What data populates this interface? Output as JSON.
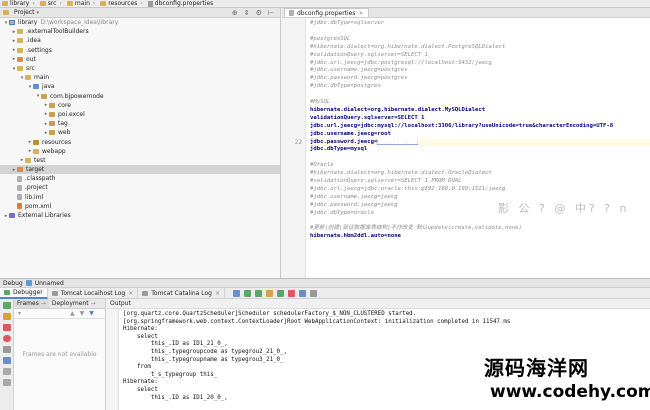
{
  "breadcrumb": [
    "library",
    "src",
    "main",
    "resources",
    "dbconfig.properties"
  ],
  "project_panel": {
    "title": "Project",
    "tree": [
      {
        "label": "library",
        "path": "D:\\workspace_idea\\library",
        "icon": "module",
        "indent": 0,
        "arrow": "▾"
      },
      {
        "label": ".externalToolBuilders",
        "icon": "folder",
        "indent": 1,
        "arrow": "▸"
      },
      {
        "label": ".idea",
        "icon": "folder",
        "indent": 1,
        "arrow": "▸"
      },
      {
        "label": ".settings",
        "icon": "folder",
        "indent": 1,
        "arrow": "▸"
      },
      {
        "label": "out",
        "icon": "excl",
        "indent": 1,
        "arrow": "▸"
      },
      {
        "label": "src",
        "icon": "folder",
        "indent": 1,
        "arrow": "▾"
      },
      {
        "label": "main",
        "icon": "folder",
        "indent": 2,
        "arrow": "▾"
      },
      {
        "label": "java",
        "icon": "src",
        "indent": 3,
        "arrow": "▾"
      },
      {
        "label": "com.bjpowernode",
        "icon": "pkg",
        "indent": 4,
        "arrow": "▾"
      },
      {
        "label": "core",
        "icon": "pkg",
        "indent": 5,
        "arrow": "▸"
      },
      {
        "label": "poi.excel",
        "icon": "pkg",
        "indent": 5,
        "arrow": "▸"
      },
      {
        "label": "tag",
        "icon": "pkg",
        "indent": 5,
        "arrow": "▸"
      },
      {
        "label": "web",
        "icon": "pkg",
        "indent": 5,
        "arrow": "▸"
      },
      {
        "label": "resources",
        "icon": "res",
        "indent": 3,
        "arrow": "▸"
      },
      {
        "label": "webapp",
        "icon": "folder",
        "indent": 3,
        "arrow": "▸"
      },
      {
        "label": "test",
        "icon": "folder",
        "indent": 2,
        "arrow": "▸"
      },
      {
        "label": "target",
        "icon": "excl",
        "indent": 1,
        "arrow": "▸",
        "selected": true
      },
      {
        "label": ".classpath",
        "icon": "file",
        "indent": 1,
        "arrow": ""
      },
      {
        "label": ".project",
        "icon": "file",
        "indent": 1,
        "arrow": ""
      },
      {
        "label": "lib.iml",
        "icon": "file",
        "indent": 1,
        "arrow": ""
      },
      {
        "label": "pom.xml",
        "icon": "xml",
        "indent": 1,
        "arrow": ""
      },
      {
        "label": "External Libraries",
        "icon": "lib",
        "indent": 0,
        "arrow": "▸"
      }
    ]
  },
  "editor": {
    "tab_label": "dbconfig.properties",
    "lines": [
      {
        "n": "",
        "t": "#jdbc.dbType=sqlserver",
        "k": "cmt"
      },
      {
        "n": "",
        "t": "",
        "k": "cmt"
      },
      {
        "n": "",
        "t": "#postgresSQL",
        "k": "cmt"
      },
      {
        "n": "",
        "t": "#hibernate.dialect=org.hibernate.dialect.PostgreSQLDialect",
        "k": "cmt"
      },
      {
        "n": "",
        "t": "#validationQuery.sqlserver=SELECT 1",
        "k": "cmt"
      },
      {
        "n": "",
        "t": "#jdbc.url.jeecg=jdbc:postgresql://localhost:5432/jeecg",
        "k": "cmt"
      },
      {
        "n": "",
        "t": "#jdbc.username.jeecg=postgres",
        "k": "cmt"
      },
      {
        "n": "",
        "t": "#jdbc.password.jeecg=postgres",
        "k": "cmt"
      },
      {
        "n": "",
        "t": "#jdbc.dbType=postgres",
        "k": "cmt"
      },
      {
        "n": "",
        "t": "",
        "k": "cmt"
      },
      {
        "n": "",
        "t": "#MySQL",
        "k": "cmt"
      },
      {
        "n": "",
        "t": "hibernate.dialect=org.hibernate.dialect.MySQLDialect",
        "k": "kv"
      },
      {
        "n": "",
        "t": "validationQuery.sqlserver=SELECT 1",
        "k": "kv"
      },
      {
        "n": "",
        "t": "jdbc.url.jeecg=jdbc:mysql://localhost:3306/library?useUnicode=true&characterEncoding=UTF-8",
        "k": "kv"
      },
      {
        "n": "",
        "t": "jdbc.username.jeecg=root",
        "k": "kv"
      },
      {
        "n": "22",
        "t": "jdbc.password.jeecg=",
        "k": "kv",
        "sel": "████████████",
        "hl": true
      },
      {
        "n": "",
        "t": "jdbc.dbType=mysql",
        "k": "kv"
      },
      {
        "n": "",
        "t": "",
        "k": "cmt"
      },
      {
        "n": "",
        "t": "#Oracle",
        "k": "cmt"
      },
      {
        "n": "",
        "t": "#hibernate.dialect=org.hibernate.dialect.OracleDialect",
        "k": "cmt"
      },
      {
        "n": "",
        "t": "#validationQuery.sqlserver=SELECT 1 FROM DUAL",
        "k": "cmt"
      },
      {
        "n": "",
        "t": "#jdbc.url.jeecg=jdbc:oracle:thin:@192.168.0.199:1521:jeecg",
        "k": "cmt"
      },
      {
        "n": "",
        "t": "#jdbc.username.jeecg=jeecg",
        "k": "cmt"
      },
      {
        "n": "",
        "t": "#jdbc.password.jeecg=jeecg",
        "k": "cmt"
      },
      {
        "n": "",
        "t": "#jdbc.dbType=oracle",
        "k": "cmt"
      },
      {
        "n": "",
        "t": "",
        "k": "cmt"
      },
      {
        "n": "",
        "t": "#更新|创建|验证数据库表结构|不作改变     默认update(create,validate,none)",
        "k": "cmt"
      },
      {
        "n": "",
        "t": "hibernate.hbm2ddl.auto=none",
        "k": "kv"
      }
    ]
  },
  "watermark": "影 公 ?  @ 中?  ?  n",
  "debug": {
    "title": "Debug",
    "config_name": "Unnamed",
    "tabs": [
      {
        "label": "Debugger",
        "active": true
      },
      {
        "label": "Tomcat Localhost Log",
        "active": false
      },
      {
        "label": "Tomcat Catalina Log",
        "active": false
      }
    ],
    "frames_tab": "Frames",
    "frames_tab2": "Deployment",
    "frames_empty": "Frames are not available",
    "output_title": "Output",
    "output_lines": [
      "[org.quartz.core.QuartzScheduler]Scheduler schedulerFactory_$_NON_CLUSTERED started.",
      "[org.springframework.web.context.ContextLoader]Root WebApplicationContext: initialization completed in 11547 ms",
      "Hibernate:",
      "    select",
      "        this_.ID as ID1_21_0_,",
      "        this_.typegroupcode as typegrou2_21_0_,",
      "        this_.typegroupname as typegrou3_21_0_",
      "    from",
      "        t_s_typegroup this_",
      "Hibernate:",
      "    select",
      "        this_.ID as ID1_20_0_,"
    ]
  },
  "brand": {
    "cn": "源码海洋网",
    "url": "www.codehy.com"
  }
}
